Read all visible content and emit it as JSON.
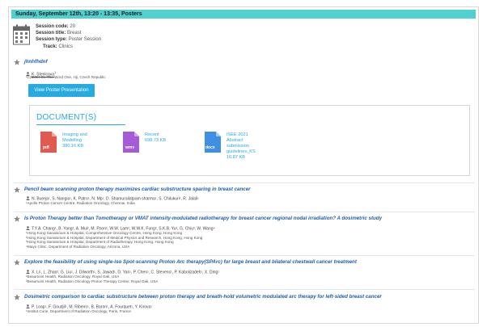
{
  "session": {
    "header": "Sunday, September 12th, 13:20 - 13:35, Posters",
    "code_label": "Session code:",
    "code_value": "20",
    "title_label": "Session title:",
    "title_value": "Breast",
    "type_label": "Session type:",
    "type_value": "Poster Session",
    "track_label": "Track:",
    "track_value": "Clinics"
  },
  "first_item": {
    "title": "jhnhfhdnf",
    "author": "K. Stenlcova",
    "affiliation": "¹CZECH-IN, The Word One, Hji, Czech Republic",
    "button_label": "View Poster Presentation",
    "documents_title": "DOCUMENT(S)",
    "documents": [
      {
        "type": "pdf",
        "name_lines": [
          "Imaging and",
          "Modelling"
        ],
        "size": "380.16 KB",
        "color": "#e05a4f"
      },
      {
        "type": "wmv",
        "name_lines": [
          "Recent"
        ],
        "size": "698.73 KB",
        "color": "#a35bd6"
      },
      {
        "type": "docx",
        "name_lines": [
          "ISEE 2021",
          "Abstract",
          "submission",
          "guidelines_KS"
        ],
        "size": "16.87 KB",
        "color": "#3f8fe5"
      }
    ]
  },
  "items": [
    {
      "title": "Pencil beam scanning proton therapy maximizes cardiac substructure sparing in breast cancer",
      "authors": "N. Bureja¹, S. Nangia¹, K. Patro¹, N. Mp¹, D. Shamurailatpam sharma¹, S. Chilukuri¹, R. Jalali¹",
      "affiliations": [
        "¹Apollo Proton Cancer Centre, Radiation Oncology, Chennai, India"
      ]
    },
    {
      "title": "Is Proton Therapy better than Tomotherapy or VMAT intensity-modulated radiotherapy for breast cancer regional nodal irradiation? A dosimetric study",
      "authors": "T.Y.A. Chang¹, B. Yang², A. Mui², M. Poon², W.W. Lam², W.W.K. Fung², S.K.B. Yu², G. Chiu³, W. Wang⁴",
      "affiliations": [
        "¹Hong Kong Sanatorium & Hospital, Comprehensive Oncology Centre, Hong Kong, Hong Kong",
        "²Hong Kong Sanatorium & Hospital, Department of Medical Physics and Research, Hong Kong, Hong Kong",
        "³Hong Kong Sanatorium & Hospital, Department of Radiotherapy, Hong Kong, Hong Kong",
        "⁴Mayo Clinic, Department of Radiation Oncology, Arizona, USA"
      ]
    },
    {
      "title": "Explore the feasibility of using single-iso Spot-scanning Proton Arc therapy(SPArc) for large breast and bilateral chestwall cancer treatment",
      "authors": "X. Li¹, L. Zhao², G. Liu¹, J. Dilworth¹, S. Jawad¹, D. Yan¹, P. Chen¹, C. Stevens¹, P. Kabolizadeh¹, X. Ding¹",
      "affiliations": [
        "¹Beaumont Health, Radiation Oncology, Royal Oak, USA",
        "²Beaumont Health, Radiation Oncology Proton Therapy Center, Royal Oak, USA"
      ]
    },
    {
      "title": "Dosimetric comparison to cardiac substructure between proton therapy and breath-hold volumetric modulated arc therapy for left-sided breast cancer",
      "authors": "P. Loap¹, F. Goudjil¹, M. Ribeiro¹, B. Baron¹, A. Fourquet¹, Y. Kirova¹",
      "affiliations": [
        "¹Institut Curie, Department of Radiation Oncology, Paris, France"
      ]
    }
  ]
}
